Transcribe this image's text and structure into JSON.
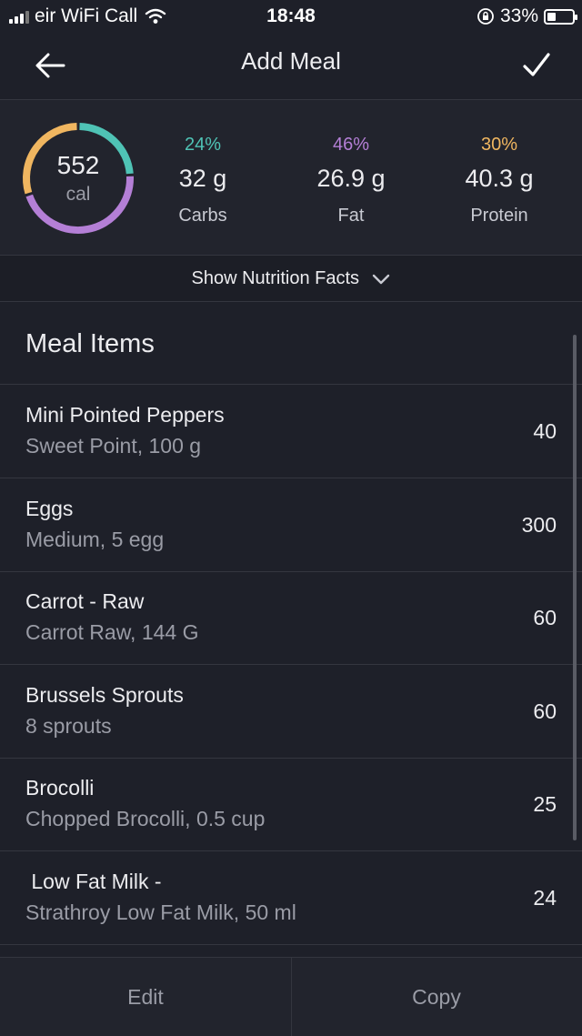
{
  "status": {
    "carrier": "eir WiFi Call",
    "time": "18:48",
    "battery": "33%",
    "battery_level": 0.33
  },
  "nav": {
    "title": "Add Meal",
    "back_icon": "arrow-left-icon",
    "confirm_icon": "checkmark-icon"
  },
  "summary": {
    "calories": "552",
    "calories_unit": "cal",
    "macros": [
      {
        "pct": "24%",
        "value": "32 g",
        "label": "Carbs",
        "color": "#4fc3b5"
      },
      {
        "pct": "46%",
        "value": "26.9 g",
        "label": "Fat",
        "color": "#b47fd6"
      },
      {
        "pct": "30%",
        "value": "40.3 g",
        "label": "Protein",
        "color": "#f0b660"
      }
    ]
  },
  "facts": {
    "label": "Show Nutrition Facts",
    "icon": "chevron-down-icon"
  },
  "meal_items": {
    "title": "Meal Items",
    "items": [
      {
        "name": "Mini Pointed Peppers",
        "detail": "Sweet Point, 100 g",
        "calories": "40"
      },
      {
        "name": "Eggs",
        "detail": "Medium, 5 egg",
        "calories": "300"
      },
      {
        "name": "Carrot - Raw",
        "detail": "Carrot Raw, 144 G",
        "calories": "60"
      },
      {
        "name": "Brussels Sprouts",
        "detail": "8 sprouts",
        "calories": "60"
      },
      {
        "name": "Brocolli",
        "detail": "Chopped Brocolli, 0.5 cup",
        "calories": "25"
      },
      {
        "name": " Low Fat Milk -",
        "detail": "Strathroy Low Fat Milk, 50 ml",
        "calories": "24"
      }
    ]
  },
  "bottom": {
    "edit": "Edit",
    "copy": "Copy"
  }
}
